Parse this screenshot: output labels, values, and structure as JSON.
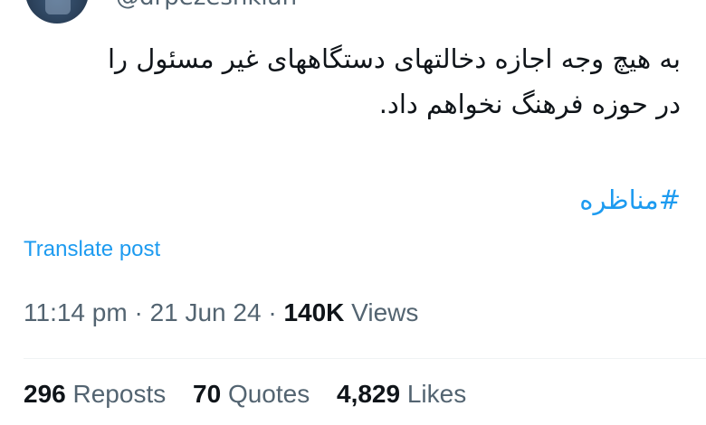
{
  "author": {
    "handle": "@drpezeshkian"
  },
  "tweet": {
    "line1": "به هیچ وجه اجازه دخالتهای دستگاههای غیر مسئول را",
    "line2": "در حوزه فرهنگ نخواهم داد.",
    "hashtag": "#مناظره"
  },
  "translate_label": "Translate post",
  "meta": {
    "time": "11:14 pm",
    "sep1": "·",
    "date": "21 Jun 24",
    "sep2": "·",
    "views_count": "140K",
    "views_label": "Views"
  },
  "stats": {
    "reposts_count": "296",
    "reposts_label": "Reposts",
    "quotes_count": "70",
    "quotes_label": "Quotes",
    "likes_count": "4,829",
    "likes_label": "Likes"
  },
  "colors": {
    "link": "#1d9bf0",
    "muted": "#536471",
    "text": "#0f1419"
  }
}
